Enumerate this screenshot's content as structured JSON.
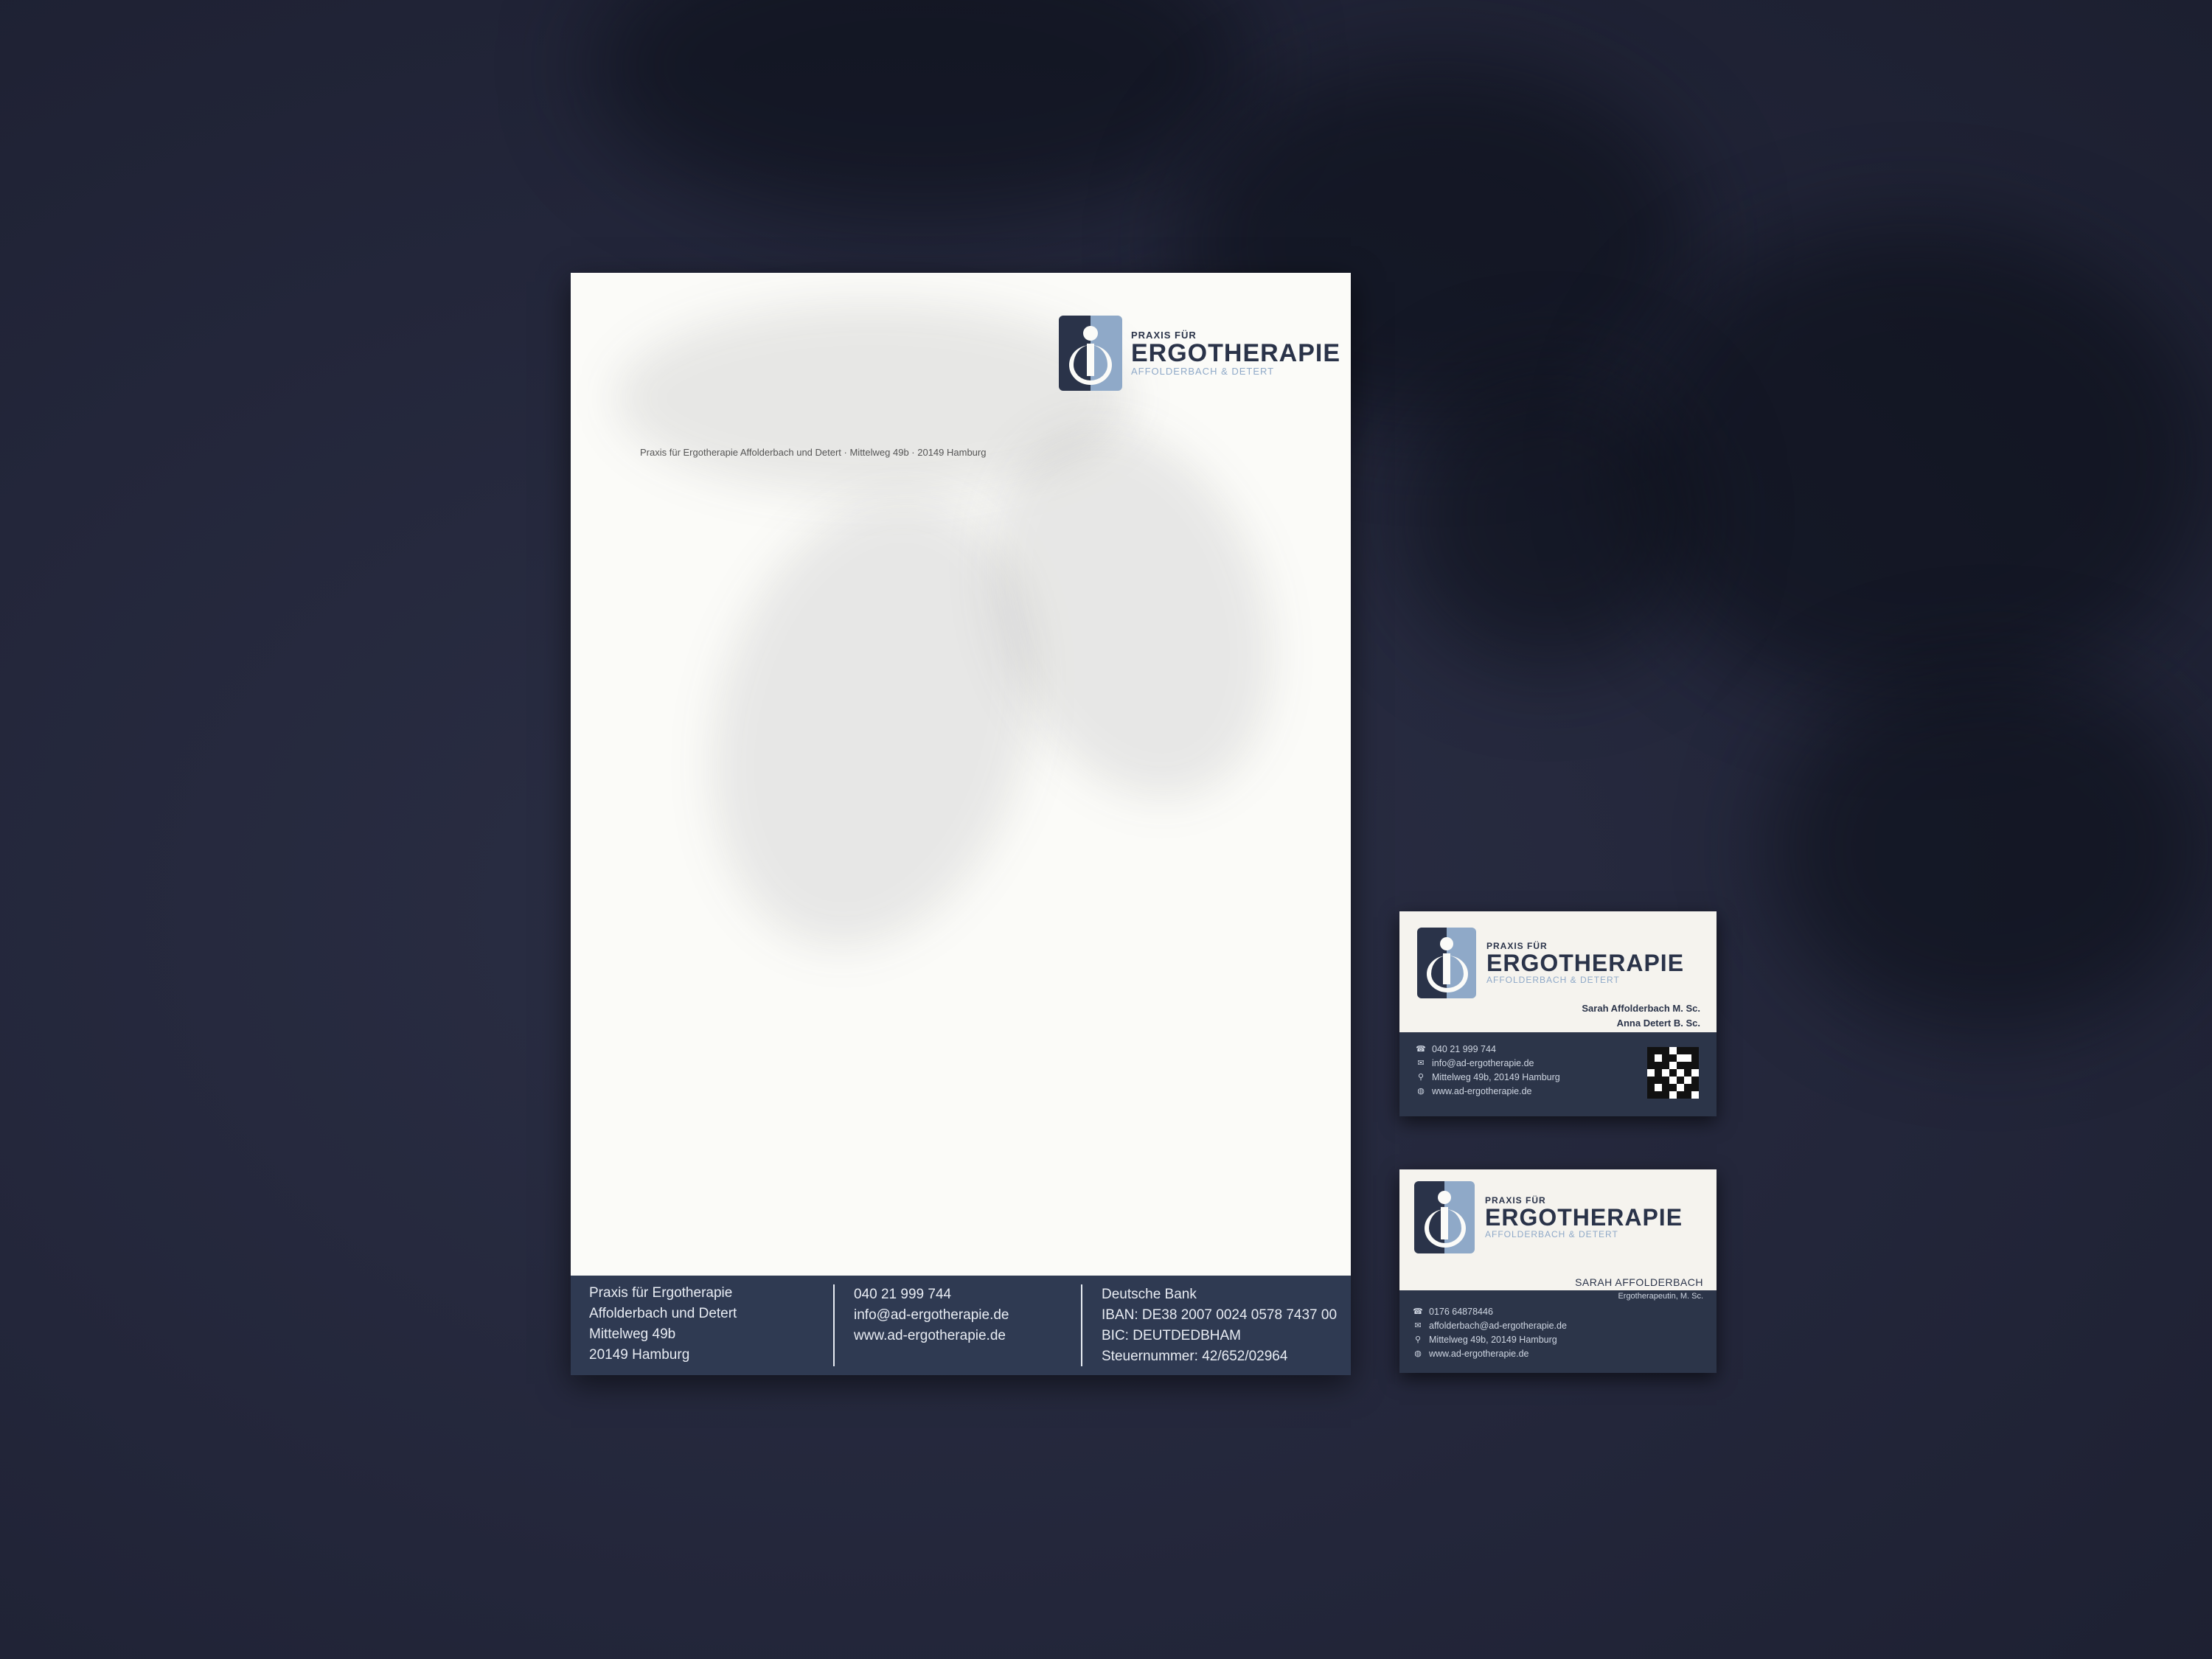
{
  "letterhead": {
    "logo": {
      "pre": "PRAXIS FÜR",
      "main": "ERGOTHERAPIE",
      "sub": "AFFOLDERBACH & DETERT"
    },
    "return_address": "Praxis für Ergotherapie Affolderbach und Detert · Mittelweg 49b · 20149 Hamburg",
    "footer": {
      "address": [
        "Praxis für Ergotherapie",
        "Affolderbach und Detert",
        "Mittelweg 49b",
        "20149 Hamburg"
      ],
      "contact": [
        "040 21 999 744",
        "info@ad-ergotherapie.de",
        "www.ad-ergotherapie.de"
      ],
      "bank": [
        "Deutsche Bank",
        "IBAN: DE38 2007 0024 0578 7437 00",
        "BIC: DEUTDEDBHAM",
        "Steuernummer: 42/652/02964"
      ]
    },
    "colors": {
      "navy": "#2f3a52",
      "light_blue": "#8fa9c8"
    }
  },
  "card_practice": {
    "logo": {
      "pre": "PRAXIS FÜR",
      "main": "ERGOTHERAPIE",
      "sub": "AFFOLDERBACH & DETERT"
    },
    "names": [
      "Sarah Affolderbach M. Sc.",
      "Anna Detert B. Sc."
    ],
    "contact": [
      {
        "icon": "phone-icon",
        "text": "040 21 999 744"
      },
      {
        "icon": "mail-icon",
        "text": "info@ad-ergotherapie.de"
      },
      {
        "icon": "location-icon",
        "text": "Mittelweg 49b, 20149 Hamburg"
      },
      {
        "icon": "globe-icon",
        "text": "www.ad-ergotherapie.de"
      }
    ]
  },
  "card_personal": {
    "logo": {
      "pre": "PRAXIS FÜR",
      "main": "ERGOTHERAPIE",
      "sub": "AFFOLDERBACH & DETERT"
    },
    "name": "SARAH AFFOLDERBACH",
    "title": "Ergotherapeutin, M. Sc.",
    "contact": [
      {
        "icon": "phone-icon",
        "text": "0176 64878446"
      },
      {
        "icon": "mail-icon",
        "text": "affolderbach@ad-ergotherapie.de"
      },
      {
        "icon": "location-icon",
        "text": "Mittelweg 49b, 20149 Hamburg"
      },
      {
        "icon": "globe-icon",
        "text": "www.ad-ergotherapie.de"
      }
    ]
  }
}
